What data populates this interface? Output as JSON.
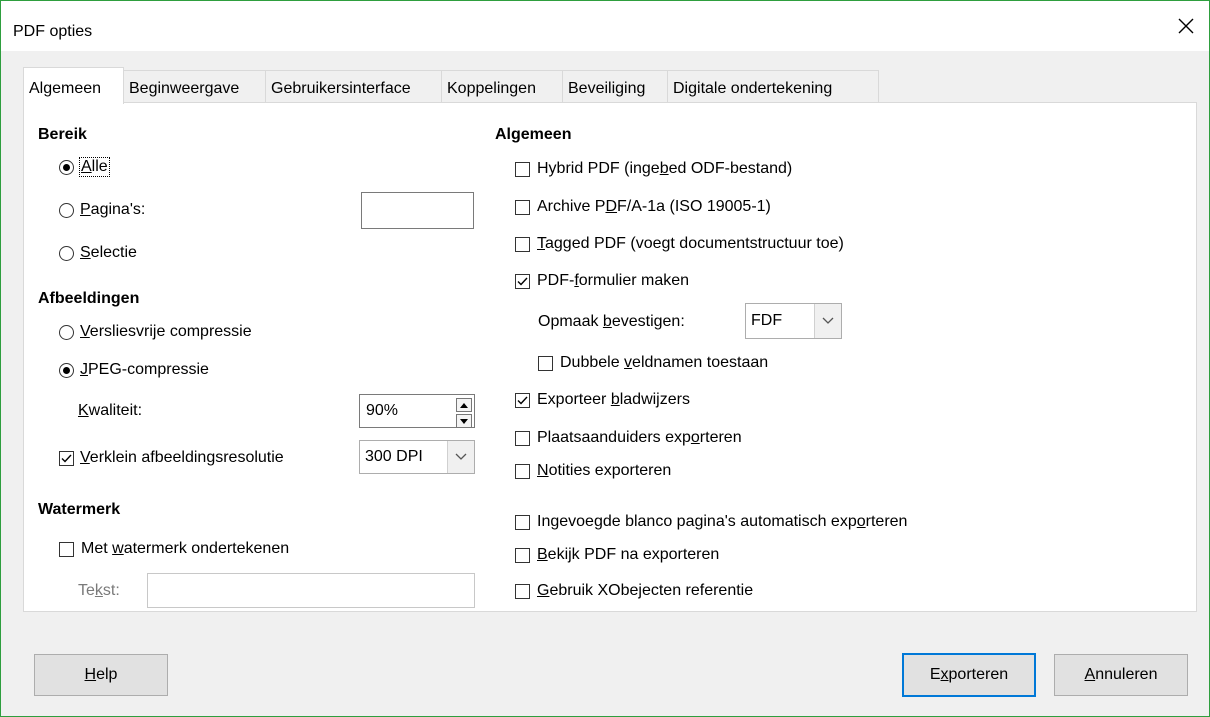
{
  "window": {
    "title": "PDF opties",
    "close_icon": "close-icon"
  },
  "tabs": [
    {
      "label": "Algemeen",
      "active": true
    },
    {
      "label": "Beginweergave"
    },
    {
      "label": "Gebruikersinterface"
    },
    {
      "label": "Koppelingen"
    },
    {
      "label": "Beveiliging"
    },
    {
      "label": "Digitale ondertekening"
    }
  ],
  "range": {
    "heading": "Bereik",
    "all_label": "Alle",
    "pages_label": "Pagina's:",
    "pages_value": "",
    "selection_label": "Selectie",
    "selected": "all"
  },
  "images": {
    "heading": "Afbeeldingen",
    "lossless_label": "Versliesvrije compressie",
    "jpeg_label": "JPEG-compressie",
    "selected": "jpeg",
    "quality_label": "Kwaliteit:",
    "quality_value": "90%",
    "reduce_label": "Verklein afbeeldingsresolutie",
    "reduce_checked": true,
    "resolution_value": "300 DPI"
  },
  "watermark": {
    "heading": "Watermerk",
    "sign_label": "Met watermerk ondertekenen",
    "sign_checked": false,
    "text_label": "Tekst:",
    "text_value": ""
  },
  "general": {
    "heading": "Algemeen",
    "hybrid_label": "Hybrid PDF (ingebed ODF-bestand)",
    "archive_label": "Archive PDF/A-1a (ISO 19005-1)",
    "tagged_label": "Tagged PDF (voegt documentstructuur toe)",
    "form_label": "PDF-formulier maken",
    "format_label": "Opmaak bevestigen:",
    "format_value": "FDF",
    "duplicate_label": "Dubbele veldnamen toestaan",
    "bookmarks_label": "Exporteer bladwijzers",
    "placeholders_label": "Plaatsaanduiders exporteren",
    "notes_label": "Notities exporteren",
    "blank_pages_label": "Ingevoegde blanco pagina's automatisch exporteren",
    "view_label": "Bekijk PDF na exporteren",
    "xobjects_label": "Gebruik XObejecten referentie"
  },
  "buttons": {
    "help": "Help",
    "export": "Exporteren",
    "cancel": "Annuleren"
  }
}
